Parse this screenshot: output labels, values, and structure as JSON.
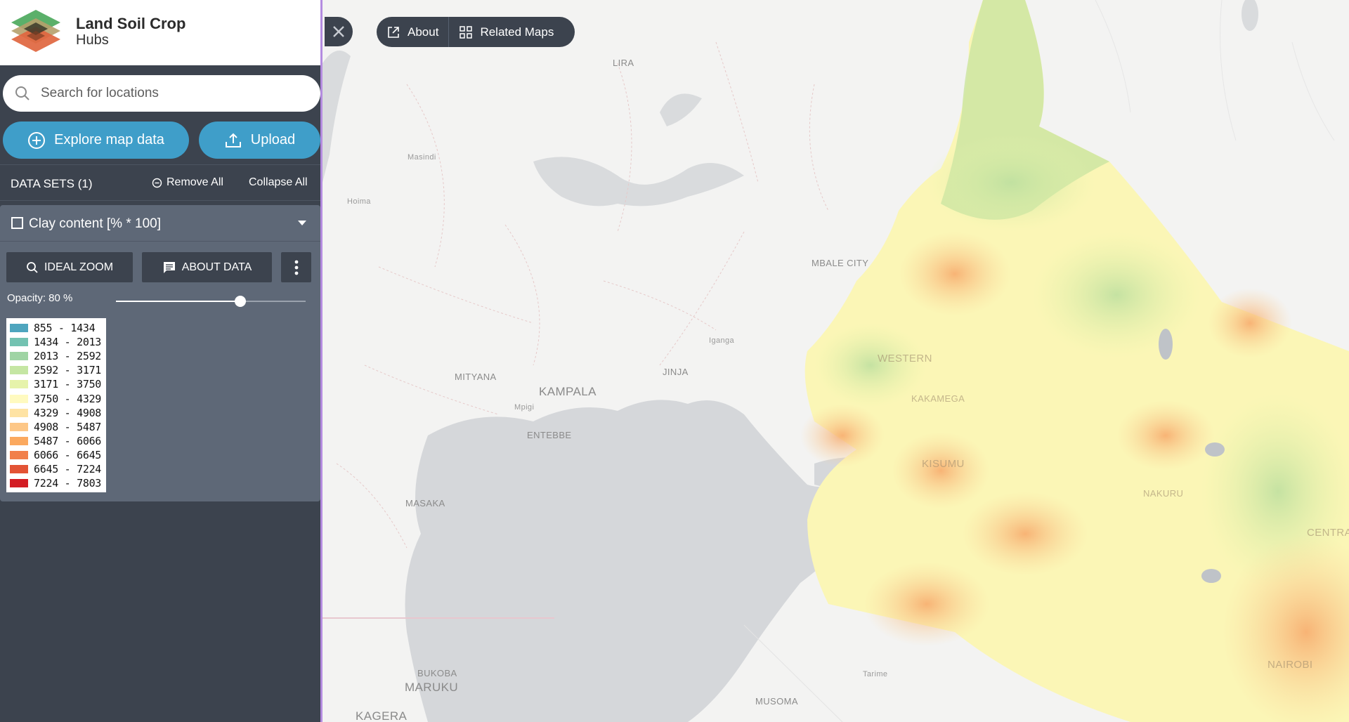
{
  "app": {
    "title": "Land Soil Crop",
    "subtitle": "Hubs"
  },
  "search": {
    "placeholder": "Search for locations"
  },
  "actions": {
    "explore_label": "Explore map data",
    "upload_label": "Upload"
  },
  "datasets": {
    "header": "DATA SETS (1)",
    "remove_all": "Remove All",
    "collapse_all": "Collapse All",
    "items": [
      {
        "name": "Clay content [% * 100]",
        "ideal_zoom": "IDEAL ZOOM",
        "about_data": "ABOUT DATA",
        "opacity_label": "Opacity: 80 %",
        "opacity_value": 0.8,
        "legend": [
          {
            "label": "855 - 1434",
            "color": "#4ea5be"
          },
          {
            "label": "1434 - 2013",
            "color": "#73c2b1"
          },
          {
            "label": "2013 - 2592",
            "color": "#9fd4a4"
          },
          {
            "label": "2592 - 3171",
            "color": "#c5e6a3"
          },
          {
            "label": "3171 - 3750",
            "color": "#e6f3ab"
          },
          {
            "label": "3750 - 4329",
            "color": "#fffac0"
          },
          {
            "label": "4329 - 4908",
            "color": "#fee3a4"
          },
          {
            "label": "4908 - 5487",
            "color": "#fdc787"
          },
          {
            "label": "5487 - 6066",
            "color": "#fba95f"
          },
          {
            "label": "6066 - 6645",
            "color": "#f17f4a"
          },
          {
            "label": "6645 - 7224",
            "color": "#e35335"
          },
          {
            "label": "7224 - 7803",
            "color": "#d31d24"
          }
        ]
      }
    ]
  },
  "map_toolbar": {
    "about_label": "About",
    "related_label": "Related Maps"
  },
  "map_labels": {
    "lira": "LIRA",
    "masindi": "Masindi",
    "hoima": "Hoima",
    "mbale": "MBALE CITY",
    "iganga": "Iganga",
    "jinja": "JINJA",
    "mityana": "MITYANA",
    "kampala": "KAMPALA",
    "mpigi": "Mpigi",
    "entebbe": "ENTEBBE",
    "masaka": "MASAKA",
    "western": "WESTERN",
    "kakamega": "KAKAMEGA",
    "kisumu": "KISUMU",
    "nakuru": "NAKURU",
    "central": "CENTRAL",
    "nairobi": "NAIROBI",
    "bukoba": "BUKOBA",
    "maruku": "MARUKU",
    "kagera": "KAGERA",
    "tarime": "Tarime",
    "musoma": "MUSOMA"
  }
}
